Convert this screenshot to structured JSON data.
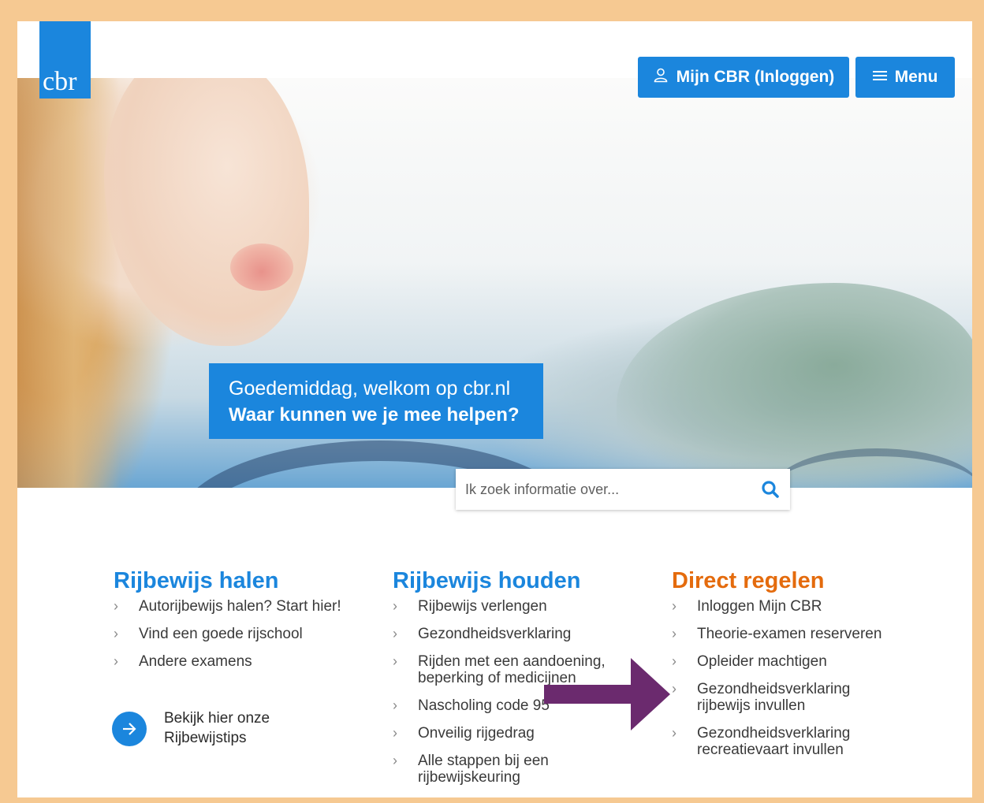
{
  "logo": {
    "text": "cbr"
  },
  "header": {
    "login_label": "Mijn CBR (Inloggen)",
    "menu_label": "Menu",
    "login_icon": "user-icon",
    "menu_icon": "hamburger-icon"
  },
  "welcome": {
    "line1": "Goedemiddag, welkom op cbr.nl",
    "line2": "Waar kunnen we je mee helpen?"
  },
  "search": {
    "placeholder": "Ik zoek informatie over...",
    "icon": "search-icon"
  },
  "columns": [
    {
      "title": "Rijbewijs halen",
      "items": [
        "Autorijbewijs halen? Start hier!",
        "Vind een goede rijschool",
        "Andere examens"
      ]
    },
    {
      "title": "Rijbewijs houden",
      "items": [
        "Rijbewijs verlengen",
        "Gezondheidsverklaring",
        "Rijden met een aandoening, beperking of medicijnen",
        "Nascholing code 95",
        "Onveilig rijgedrag",
        "Alle stappen bij een rijbewijskeuring"
      ]
    },
    {
      "title": "Direct regelen",
      "items": [
        "Inloggen Mijn CBR",
        "Theorie-examen reserveren",
        "Opleider machtigen",
        "Gezondheidsverklaring rijbewijs invullen",
        "Gezondheidsverklaring recreatievaart invullen"
      ]
    }
  ],
  "tips": {
    "line1": "Bekijk hier onze",
    "line2": "Rijbewijstips"
  },
  "colors": {
    "brand_blue": "#1b86dd",
    "accent_orange": "#e46b0d",
    "border": "#f6c992",
    "annotation_arrow": "#6b2a6e"
  }
}
